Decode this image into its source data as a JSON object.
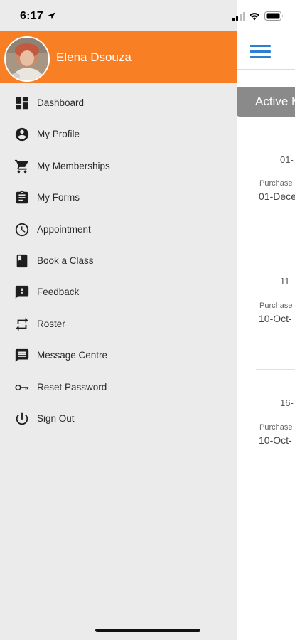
{
  "status_bar": {
    "time": "6:17"
  },
  "drawer": {
    "user_name": "Elena Dsouza",
    "header_color": "#f97f24",
    "items": [
      {
        "label": "Dashboard",
        "icon": "dashboard-icon"
      },
      {
        "label": "My Profile",
        "icon": "account-circle-icon"
      },
      {
        "label": "My Memberships",
        "icon": "shopping-cart-icon"
      },
      {
        "label": "My Forms",
        "icon": "clipboard-icon"
      },
      {
        "label": "Appointment",
        "icon": "clock-icon"
      },
      {
        "label": "Book a Class",
        "icon": "book-icon"
      },
      {
        "label": "Feedback",
        "icon": "feedback-icon"
      },
      {
        "label": "Roster",
        "icon": "repeat-icon"
      },
      {
        "label": "Message Centre",
        "icon": "message-icon"
      },
      {
        "label": "Reset Password",
        "icon": "key-icon"
      },
      {
        "label": "Sign Out",
        "icon": "power-icon"
      }
    ]
  },
  "main": {
    "tab_label": "Active M",
    "cards": [
      {
        "date": "01-",
        "purchase_label": "Purchase",
        "purchase_date": "01-Dece"
      },
      {
        "date": "11-",
        "purchase_label": "Purchase",
        "purchase_date": "10-Oct-"
      },
      {
        "date": "16-",
        "purchase_label": "Purchase",
        "purchase_date": "10-Oct-"
      }
    ]
  }
}
